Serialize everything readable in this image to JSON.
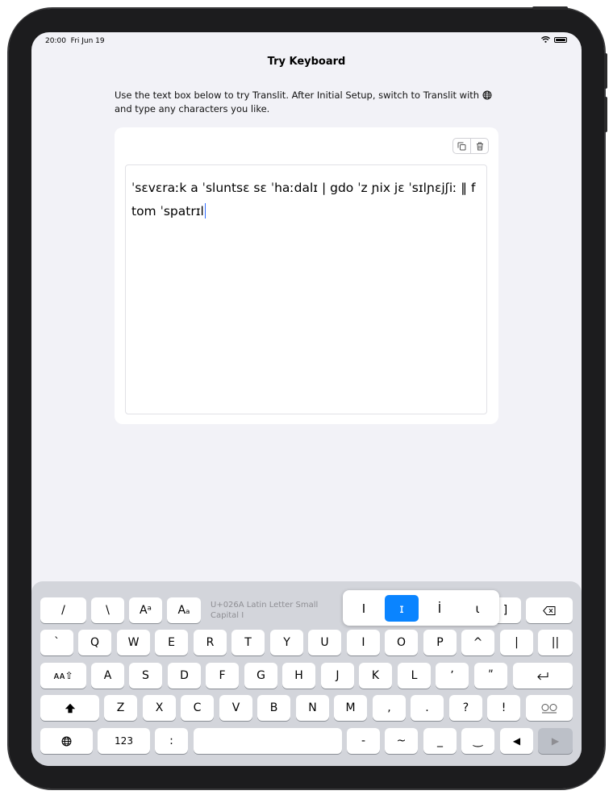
{
  "status_bar": {
    "time": "20:00",
    "date": "Fri Jun 19"
  },
  "nav": {
    "title": "Try Keyboard"
  },
  "instructions": {
    "line1": "Use the text box below to try Translit. After Initial Setup, switch to Translit with",
    "line2": "and type any characters you like."
  },
  "text_area": {
    "value": "ˈsɛvɛraːk a ˈsluntsɛ sɛ ˈhaːdalɪ | gdo ˈz ɲix jɛ ˈsɪlɲɛjʃiː ‖ f tom ˈspatrɪl"
  },
  "keyboard": {
    "unicode_info": "U+026A Latin Letter Small Capital I",
    "row1": [
      "/",
      "\\",
      "Aᵃ",
      "Aₐ",
      "]"
    ],
    "variants": [
      "I",
      "ɪ",
      "İ",
      "ɩ"
    ],
    "selected_variant": 1,
    "row2": [
      "`",
      "Q",
      "W",
      "E",
      "R",
      "T",
      "Y",
      "U",
      "I",
      "O",
      "P",
      "^",
      "|",
      "||"
    ],
    "row3": [
      "ᴀᴀ⇧",
      "A",
      "S",
      "D",
      "F",
      "G",
      "H",
      "J",
      "K",
      "L",
      "ʼ",
      "ʺ"
    ],
    "row4": [
      "Z",
      "X",
      "C",
      "V",
      "B",
      "N",
      "M",
      ",",
      ".",
      "?",
      "!"
    ],
    "row5": {
      "numbers": "123",
      "colon": ":",
      "dash": "-",
      "tilde": "~",
      "underscore": "_",
      "breve": "‿",
      "left": "◀",
      "right": "▶"
    }
  }
}
